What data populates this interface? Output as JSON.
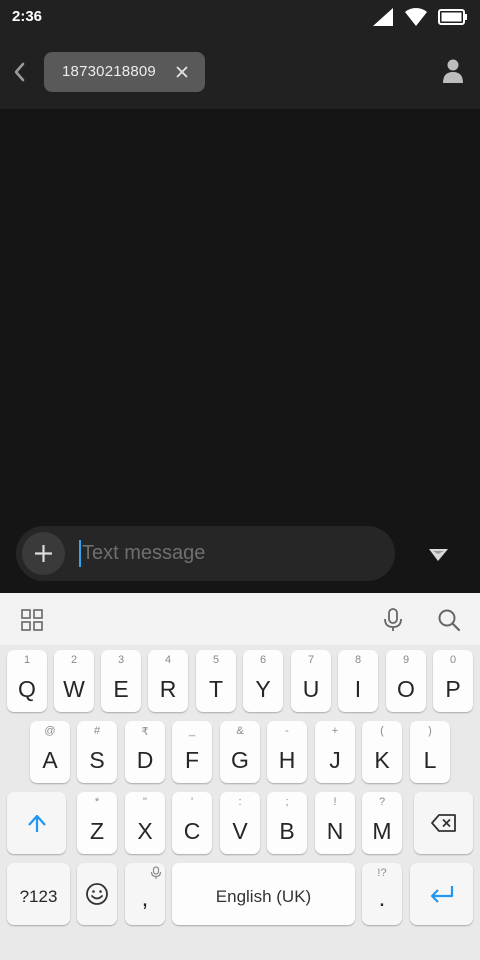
{
  "status_bar": {
    "time": "2:36"
  },
  "header": {
    "recipient": "18730218809"
  },
  "compose": {
    "placeholder": "Text message"
  },
  "keyboard": {
    "row1": [
      {
        "hint": "1",
        "label": "Q"
      },
      {
        "hint": "2",
        "label": "W"
      },
      {
        "hint": "3",
        "label": "E"
      },
      {
        "hint": "4",
        "label": "R"
      },
      {
        "hint": "5",
        "label": "T"
      },
      {
        "hint": "6",
        "label": "Y"
      },
      {
        "hint": "7",
        "label": "U"
      },
      {
        "hint": "8",
        "label": "I"
      },
      {
        "hint": "9",
        "label": "O"
      },
      {
        "hint": "0",
        "label": "P"
      }
    ],
    "row2": [
      {
        "hint": "@",
        "label": "A"
      },
      {
        "hint": "#",
        "label": "S"
      },
      {
        "hint": "₹",
        "label": "D"
      },
      {
        "hint": "_",
        "label": "F"
      },
      {
        "hint": "&",
        "label": "G"
      },
      {
        "hint": "-",
        "label": "H"
      },
      {
        "hint": "+",
        "label": "J"
      },
      {
        "hint": "(",
        "label": "K"
      },
      {
        "hint": ")",
        "label": "L"
      }
    ],
    "row3": [
      {
        "hint": "*",
        "label": "Z"
      },
      {
        "hint": "\"",
        "label": "X"
      },
      {
        "hint": "'",
        "label": "C"
      },
      {
        "hint": ":",
        "label": "V"
      },
      {
        "hint": ";",
        "label": "B"
      },
      {
        "hint": "!",
        "label": "N"
      },
      {
        "hint": "?",
        "label": "M"
      }
    ],
    "symbols_label": "?123",
    "comma_label": ",",
    "space_label": "English (UK)",
    "period_label": ".",
    "period_hint": "!?",
    "accent_color": "#2196f3"
  }
}
